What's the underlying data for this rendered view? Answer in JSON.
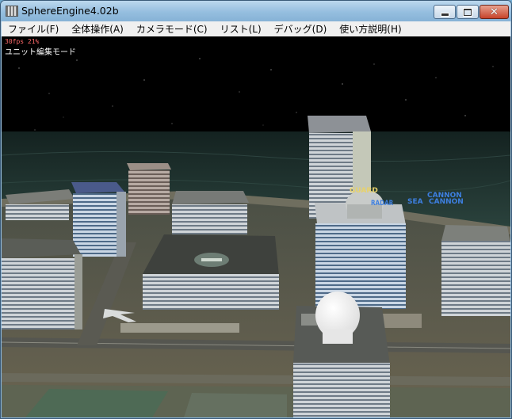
{
  "window": {
    "title": "SphereEngine4.02b"
  },
  "menu": [
    {
      "label": "ファイル(F)"
    },
    {
      "label": "全体操作(A)"
    },
    {
      "label": "カメラモード(C)"
    },
    {
      "label": "リスト(L)"
    },
    {
      "label": "デバッグ(D)"
    },
    {
      "label": "使い方説明(H)"
    }
  ],
  "hud": {
    "fps": "30fps  21%",
    "mode": "ユニット編集モード"
  },
  "unit_labels": {
    "guard": "GUARD",
    "radar": "RADAR",
    "cannon_1": "CANNON",
    "cannon_2": "CANNON",
    "sea": "SEA"
  },
  "colors": {
    "sky": "#000000",
    "sea": "#1d2f2c",
    "label_blue": "#3d7fe0",
    "label_yellow": "#e8d26a"
  }
}
